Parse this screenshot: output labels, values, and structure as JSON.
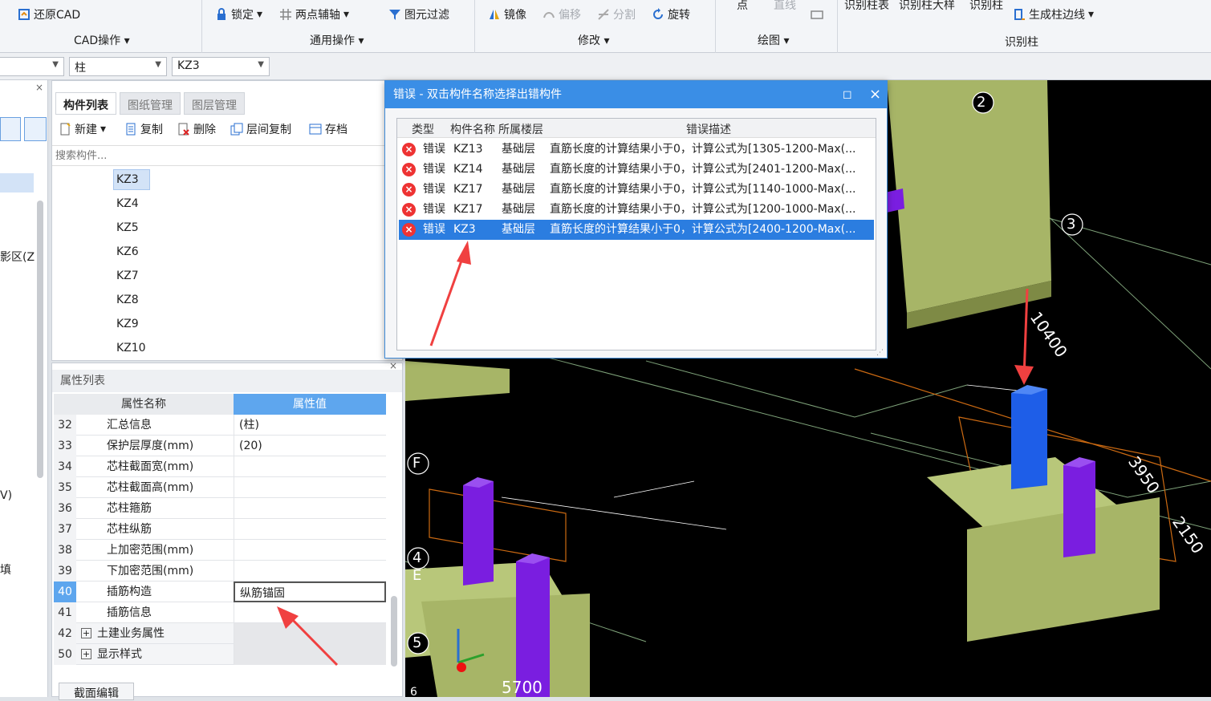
{
  "ribbon": {
    "cad_ops": {
      "restore_cad": "还原CAD",
      "group_label": "CAD操作"
    },
    "common_ops": {
      "lock": "锁定",
      "two_point_axis": "两点辅轴",
      "filter": "图元过滤",
      "group_label": "通用操作"
    },
    "modify": {
      "mirror": "镜像",
      "offset": "偏移",
      "split": "分割",
      "rotate": "旋转",
      "group_label": "修改"
    },
    "draw": {
      "point": "点",
      "line": "直线",
      "group_label": "绘图"
    },
    "identify": {
      "col_table": "识别柱表",
      "col_detail": "识别柱大样",
      "col": "识别柱",
      "gen_edge": "生成柱边线",
      "group_label": "识别柱"
    }
  },
  "toolbar2": {
    "combo1": "",
    "combo2": "柱",
    "combo3": "KZ3"
  },
  "left_strip": {
    "text1": "影区(Z",
    "text2": "V)",
    "text3": "填"
  },
  "component_panel": {
    "tabs": [
      "构件列表",
      "图纸管理",
      "图层管理"
    ],
    "tools": {
      "new": "新建",
      "copy": "复制",
      "delete": "删除",
      "floor_copy": "层间复制",
      "archive": "存档"
    },
    "search_placeholder": "搜索构件...",
    "items": [
      "KZ3",
      "KZ4",
      "KZ5",
      "KZ6",
      "KZ7",
      "KZ8",
      "KZ9",
      "KZ10"
    ]
  },
  "props_panel": {
    "title": "属性列表",
    "col_name": "属性名称",
    "col_value": "属性值",
    "rows": [
      {
        "no": "32",
        "name": "汇总信息",
        "value": "(柱)"
      },
      {
        "no": "33",
        "name": "保护层厚度(mm)",
        "value": "(20)"
      },
      {
        "no": "34",
        "name": "芯柱截面宽(mm)",
        "value": ""
      },
      {
        "no": "35",
        "name": "芯柱截面高(mm)",
        "value": ""
      },
      {
        "no": "36",
        "name": "芯柱箍筋",
        "value": ""
      },
      {
        "no": "37",
        "name": "芯柱纵筋",
        "value": ""
      },
      {
        "no": "38",
        "name": "上加密范围(mm)",
        "value": ""
      },
      {
        "no": "39",
        "name": "下加密范围(mm)",
        "value": ""
      },
      {
        "no": "40",
        "name": "插筋构造",
        "value": "纵筋锚固"
      },
      {
        "no": "41",
        "name": "插筋信息",
        "value": ""
      },
      {
        "no": "42",
        "name": "土建业务属性",
        "value": ""
      },
      {
        "no": "50",
        "name": "显示样式",
        "value": ""
      }
    ],
    "bottom_tab": "截面编辑"
  },
  "dialog": {
    "title": "错误 - 双击构件名称选择出错构件",
    "headers": {
      "type": "类型",
      "name": "构件名称",
      "floor": "所属楼层",
      "desc": "错误描述"
    },
    "rows": [
      {
        "type": "错误",
        "name": "KZ13",
        "floor": "基础层",
        "desc": "直筋长度的计算结果小于0，计算公式为[1305-1200-Max(..."
      },
      {
        "type": "错误",
        "name": "KZ14",
        "floor": "基础层",
        "desc": "直筋长度的计算结果小于0，计算公式为[2401-1200-Max(..."
      },
      {
        "type": "错误",
        "name": "KZ17",
        "floor": "基础层",
        "desc": "直筋长度的计算结果小于0，计算公式为[1140-1000-Max(..."
      },
      {
        "type": "错误",
        "name": "KZ17",
        "floor": "基础层",
        "desc": "直筋长度的计算结果小于0，计算公式为[1200-1000-Max(..."
      },
      {
        "type": "错误",
        "name": "KZ3",
        "floor": "基础层",
        "desc": "直筋长度的计算结果小于0，计算公式为[2400-1200-Max(..."
      }
    ]
  },
  "cad": {
    "axis_labels": [
      "2",
      "3",
      "F",
      "4",
      "E",
      "5",
      "6"
    ],
    "dims": [
      "10400",
      "3950",
      "5700",
      "2150"
    ]
  },
  "colors": {
    "accent": "#3a8ee6",
    "column_blue": "#1e5ee8",
    "column_purple": "#7a1ee0",
    "footing": "#a7b567",
    "error": "#e33333"
  }
}
